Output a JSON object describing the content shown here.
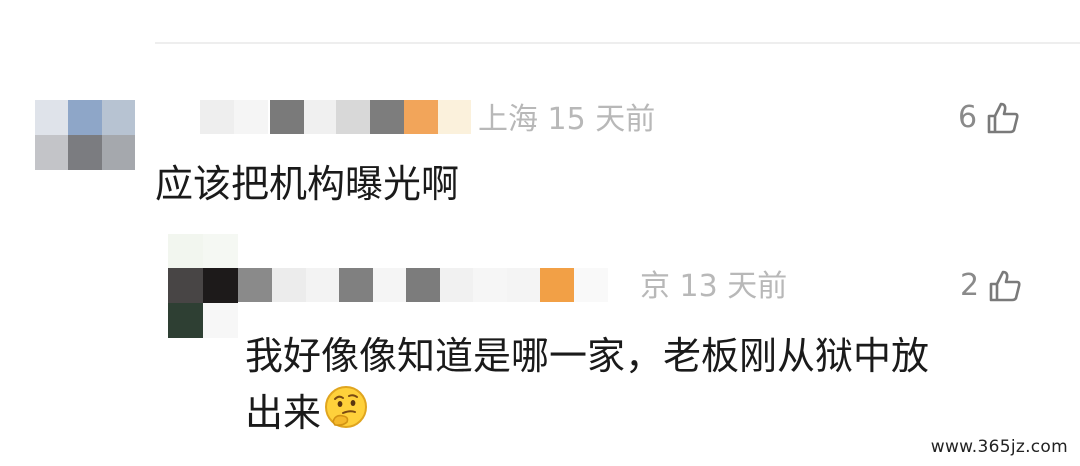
{
  "comments": [
    {
      "location": "上海",
      "time": "15 天前",
      "likes": "6",
      "text": "应该把机构曝光啊"
    },
    {
      "location_fragment": "京",
      "time": "13 天前",
      "likes": "2",
      "text_line1": "我好像像知道是哪一家，老板刚从狱中放",
      "text_line2": "出来",
      "emoji": "🤔"
    }
  ],
  "watermark": "www.365jz.com",
  "icons": {
    "like": "thumbs-up-icon",
    "emoji": "thinking-face-emoji"
  }
}
